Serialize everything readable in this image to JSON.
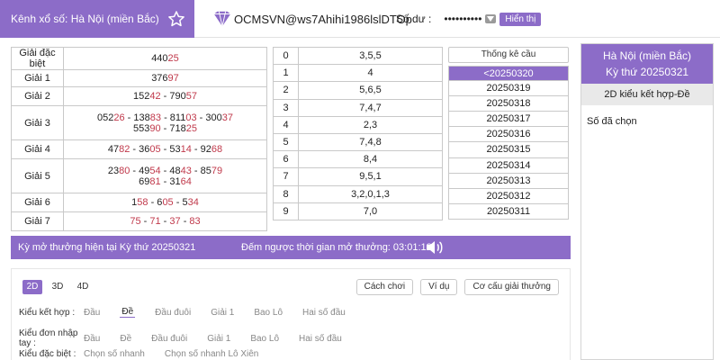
{
  "header": {
    "channel": "Kênh xổ số: Hà Nội (miền Bắc)",
    "username": "OCMSVN@ws7Ahihi1986lslDTOp",
    "balance_label": "Số dư :",
    "balance_masked": "••••••••••",
    "show_label": "Hiển thị"
  },
  "prizes": [
    {
      "name": "Giải đặc biệt",
      "lines": [
        [
          {
            "t": "440",
            "r": false
          },
          {
            "t": "25",
            "r": true
          }
        ]
      ]
    },
    {
      "name": "Giải 1",
      "lines": [
        [
          {
            "t": "376",
            "r": false
          },
          {
            "t": "97",
            "r": true
          }
        ]
      ]
    },
    {
      "name": "Giải 2",
      "lines": [
        [
          {
            "t": "152",
            "r": false
          },
          {
            "t": "42",
            "r": true
          },
          {
            "t": " - 790",
            "r": false
          },
          {
            "t": "57",
            "r": true
          }
        ]
      ]
    },
    {
      "name": "Giải 3",
      "lines": [
        [
          {
            "t": "052",
            "r": false
          },
          {
            "t": "26",
            "r": true
          },
          {
            "t": " - 138",
            "r": false
          },
          {
            "t": "83",
            "r": true
          },
          {
            "t": " - 811",
            "r": false
          },
          {
            "t": "03",
            "r": true
          },
          {
            "t": " - 300",
            "r": false
          },
          {
            "t": "37",
            "r": true
          }
        ],
        [
          {
            "t": "553",
            "r": false
          },
          {
            "t": "90",
            "r": true
          },
          {
            "t": " - 718",
            "r": false
          },
          {
            "t": "25",
            "r": true
          }
        ]
      ]
    },
    {
      "name": "Giải 4",
      "lines": [
        [
          {
            "t": "47",
            "r": false
          },
          {
            "t": "82",
            "r": true
          },
          {
            "t": " - 36",
            "r": false
          },
          {
            "t": "05",
            "r": true
          },
          {
            "t": " - 53",
            "r": false
          },
          {
            "t": "14",
            "r": true
          },
          {
            "t": " - 92",
            "r": false
          },
          {
            "t": "68",
            "r": true
          }
        ]
      ]
    },
    {
      "name": "Giải 5",
      "lines": [
        [
          {
            "t": "23",
            "r": false
          },
          {
            "t": "80",
            "r": true
          },
          {
            "t": " - 49",
            "r": false
          },
          {
            "t": "54",
            "r": true
          },
          {
            "t": " - 48",
            "r": false
          },
          {
            "t": "43",
            "r": true
          },
          {
            "t": " - 85",
            "r": false
          },
          {
            "t": "79",
            "r": true
          }
        ],
        [
          {
            "t": "69",
            "r": false
          },
          {
            "t": "81",
            "r": true
          },
          {
            "t": " - 31",
            "r": false
          },
          {
            "t": "64",
            "r": true
          }
        ]
      ]
    },
    {
      "name": "Giải 6",
      "lines": [
        [
          {
            "t": "1",
            "r": false
          },
          {
            "t": "58",
            "r": true
          },
          {
            "t": " - 6",
            "r": false
          },
          {
            "t": "05",
            "r": true
          },
          {
            "t": " - 5",
            "r": false
          },
          {
            "t": "34",
            "r": true
          }
        ]
      ]
    },
    {
      "name": "Giải 7",
      "lines": [
        [
          {
            "t": "75",
            "r": true
          },
          {
            "t": " - ",
            "r": false
          },
          {
            "t": "71",
            "r": true
          },
          {
            "t": " - ",
            "r": false
          },
          {
            "t": "37",
            "r": true
          },
          {
            "t": " - ",
            "r": false
          },
          {
            "t": "83",
            "r": true
          }
        ]
      ]
    }
  ],
  "head_tail": [
    {
      "digit": "0",
      "values": "3,5,5"
    },
    {
      "digit": "1",
      "values": "4"
    },
    {
      "digit": "2",
      "values": "5,6,5"
    },
    {
      "digit": "3",
      "values": "7,4,7"
    },
    {
      "digit": "4",
      "values": "2,3"
    },
    {
      "digit": "5",
      "values": "7,4,8"
    },
    {
      "digit": "6",
      "values": "8,4"
    },
    {
      "digit": "7",
      "values": "9,5,1"
    },
    {
      "digit": "8",
      "values": "3,2,0,1,3"
    },
    {
      "digit": "9",
      "values": "7,0"
    }
  ],
  "stats": {
    "button_label": "Thống kê cầu",
    "dates": [
      "<20250320",
      "20250319",
      "20250318",
      "20250317",
      "20250316",
      "20250315",
      "20250314",
      "20250313",
      "20250312",
      "20250311"
    ]
  },
  "right_panel": {
    "title_line1": "Hà Nội (miền Bắc)",
    "title_line2": "Kỳ thứ 20250321",
    "subtitle": "2D kiểu kết hợp-Đề",
    "chosen_label": "Số đã chọn"
  },
  "countdown": {
    "period_text": "Kỳ mở thưởng hiện tại Kỳ thứ 20250321",
    "countdown_text": "Đếm ngược thời gian mở thưởng: 03:01:13"
  },
  "game": {
    "tabs": [
      "2D",
      "3D",
      "4D"
    ],
    "buttons": [
      "Cách chơi",
      "Ví dụ",
      "Cơ cấu giải thưởng"
    ],
    "rows": [
      {
        "label": "Kiểu kết hợp :",
        "options": [
          "Đầu",
          "Đề",
          "Đầu đuôi",
          "Giải 1",
          "Bao Lô",
          "Hai số đầu"
        ],
        "selected": 1
      },
      {
        "label": "Kiểu đơn nhập tay :",
        "options": [
          "Đầu",
          "Đề",
          "Đầu đuôi",
          "Giải 1",
          "Bao Lô",
          "Hai số đầu"
        ],
        "selected": -1
      },
      {
        "label": "Kiểu đặc biệt :",
        "options": [
          "Chọn số nhanh",
          "Chọn số nhanh Lô Xiên"
        ],
        "selected": -1
      }
    ]
  },
  "colors": {
    "accent": "#8c6cc8",
    "highlight_digits": "#c0394b"
  },
  "icons": {
    "star": "star-icon",
    "user": "diamond-user-icon",
    "eye": "eye-toggle-icon",
    "sound": "speaker-icon"
  }
}
